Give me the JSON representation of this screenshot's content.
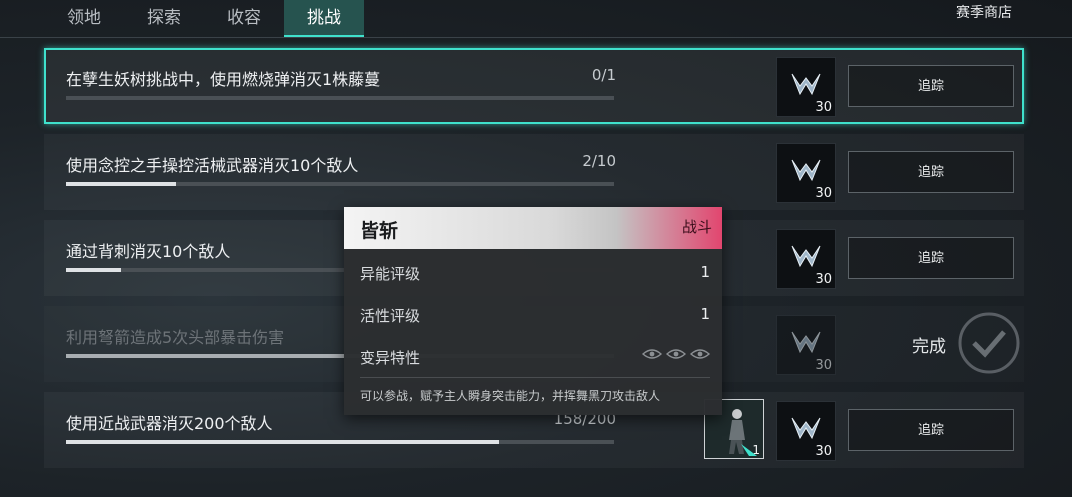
{
  "tabs": [
    {
      "label": "领地",
      "active": false
    },
    {
      "label": "探索",
      "active": false
    },
    {
      "label": "收容",
      "active": false
    },
    {
      "label": "挑战",
      "active": true
    }
  ],
  "shop_label": "赛季商店",
  "colors": {
    "accent": "#3fe1cc",
    "tag_red": "#e2466f"
  },
  "quests": [
    {
      "text": "在孽生妖树挑战中，使用燃烧弹消灭1株藤蔓",
      "progress": "0/1",
      "fraction": 0.0,
      "reward_icon": "currency-m-icon",
      "reward_qty": "30",
      "action": "追踪",
      "selected": true
    },
    {
      "text": "使用念控之手操控活械武器消灭10个敌人",
      "progress": "2/10",
      "fraction": 0.2,
      "reward_icon": "currency-m-icon",
      "reward_qty": "30",
      "action": "追踪"
    },
    {
      "text": "通过背刺消灭10个敌人",
      "progress": "",
      "fraction": 0.1,
      "reward_icon": "currency-m-icon",
      "reward_qty": "30",
      "action": "追踪"
    },
    {
      "text": "利用弩箭造成5次头部暴击伤害",
      "progress": "",
      "fraction": 1.0,
      "reward_icon": "currency-m-icon",
      "reward_qty": "30",
      "action": "完成",
      "done": true
    },
    {
      "text": "使用近战武器消灭200个敌人",
      "progress": "158/200",
      "fraction": 0.79,
      "reward_icon": "currency-m-icon",
      "reward_qty": "30",
      "action": "追踪",
      "extra_reward_icon": "companion-figure-icon",
      "extra_reward_qty": "1"
    }
  ],
  "tooltip": {
    "name": "皆斩",
    "tag": "战斗",
    "rows": [
      {
        "label": "异能评级",
        "value": "1"
      },
      {
        "label": "活性评级",
        "value": "1"
      },
      {
        "label": "变异特性",
        "value": "",
        "icons": [
          "eye-icon",
          "eye-icon",
          "eye-icon"
        ]
      }
    ],
    "description": "可以参战，赋予主人瞬身突击能力，并挥舞黑刀攻击敌人"
  }
}
